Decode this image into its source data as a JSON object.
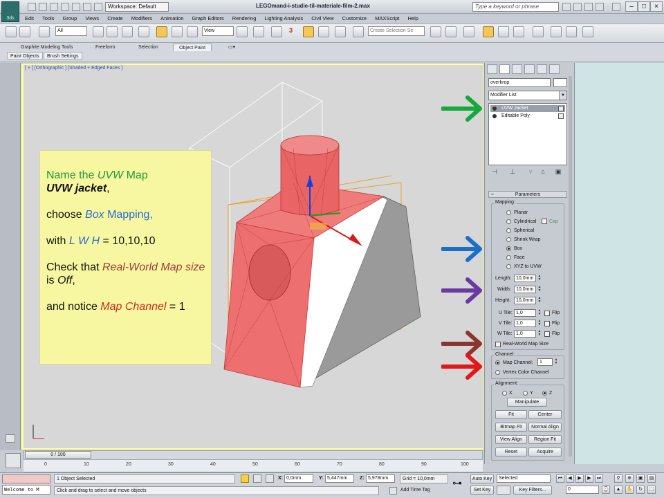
{
  "app": {
    "logo_text": "3ds",
    "workspace": "Workspace: Default",
    "document_title": "LEGOmand-i-studie-til-materiale-film-2.max",
    "search_placeholder": "Type a keyword or phrase"
  },
  "menu": [
    "Edit",
    "Tools",
    "Group",
    "Views",
    "Create",
    "Modifiers",
    "Animation",
    "Graph Editors",
    "Rendering",
    "Lighting Analysis",
    "Civil View",
    "Customize",
    "MAXScript",
    "Help"
  ],
  "toolbar": {
    "filter": "All",
    "reference_coord": "View",
    "selection_set_placeholder": "Create Selection Se",
    "snap_label": "3"
  },
  "ribbon": {
    "tabs": [
      "Graphite Modeling Tools",
      "Freeform",
      "Selection",
      "Object Paint"
    ],
    "active_tab": "Object Paint",
    "subtabs": [
      "Paint Objects",
      "Brush Settings"
    ]
  },
  "viewport": {
    "label": "[ + ] [Orthographic ] [Shaded + Edged Faces ]"
  },
  "note": {
    "line1_prefix": "Name the ",
    "line1_em": "UVW",
    "line1_suffix": " Map",
    "line2_em": "UVW jacket",
    "line2_suffix": ",",
    "line3_prefix": "choose ",
    "line3_em": "Box",
    "line3_suffix": " Mapping,",
    "line4_prefix": "with ",
    "line4_em": "L W H",
    "line4_suffix": " = 10,10,10",
    "line5_prefix": "Check that ",
    "line5_em": "Real-World Map size",
    "line5_mid": " is ",
    "line5_em2": "Off",
    "line5_suffix": ",",
    "line6_prefix": "and notice ",
    "line6_em": "Map Channel",
    "line6_suffix": " = 1"
  },
  "command_panel": {
    "object_name": "overkrop",
    "modifier_list": "Modifier List",
    "stack": [
      {
        "label": "UVW Jacket",
        "selected": true
      },
      {
        "label": "Editable Poly",
        "selected": false
      }
    ],
    "parameters_title": "Parameters",
    "mapping_title": "Mapping:",
    "mapping_options": [
      "Planar",
      "Cylindrical",
      "Spherical",
      "Shrink Wrap",
      "Box",
      "Face",
      "XYZ to UVW"
    ],
    "mapping_selected": "Box",
    "cap_label": "Cap",
    "length_label": "Length:",
    "length_value": "10,0mm",
    "width_label": "Width:",
    "width_value": "10,0mm",
    "height_label": "Height:",
    "height_value": "10,0mm",
    "u_tile_label": "U Tile:",
    "u_tile_value": "1,0",
    "v_tile_label": "V Tile:",
    "v_tile_value": "1,0",
    "w_tile_label": "W Tile:",
    "w_tile_value": "1,0",
    "flip_label": "Flip",
    "real_world_label": "Real-World Map Size",
    "real_world_checked": false,
    "channel_title": "Channel:",
    "map_channel_label": "Map Channel:",
    "map_channel_value": "1",
    "vertex_color_label": "Vertex Color Channel",
    "alignment_title": "Alignment:",
    "axes": [
      "X",
      "Y",
      "Z"
    ],
    "axis_selected": "Z",
    "buttons": [
      "Manipulate",
      "Fit",
      "Center",
      "Bitmap Fit",
      "Normal Align",
      "View Align",
      "Region Fit",
      "Reset",
      "Acquire"
    ]
  },
  "arrows": {
    "colors": [
      "#15a83a",
      "#1a6fc9",
      "#6a3aa2",
      "#8b3530",
      "#e01818"
    ]
  },
  "timeline": {
    "slider": "0 / 100",
    "ticks": [
      "0",
      "10",
      "20",
      "30",
      "40",
      "50",
      "60",
      "70",
      "80",
      "90",
      "100"
    ]
  },
  "status": {
    "welcome": "Welcome to M",
    "selection": "1 Object Selected",
    "prompt": "Click and drag to select and move objects",
    "x_label": "X:",
    "x_value": "0,0mm",
    "y_label": "Y:",
    "y_value": "5,447mm",
    "z_label": "Z:",
    "z_value": "5,978mm",
    "grid": "Grid = 10,0mm",
    "add_time_tag": "Add Time Tag",
    "auto_key": "Auto Key",
    "set_key": "Set Key",
    "key_mode": "Selected",
    "key_filters": "Key Filters...",
    "frame": "0"
  }
}
